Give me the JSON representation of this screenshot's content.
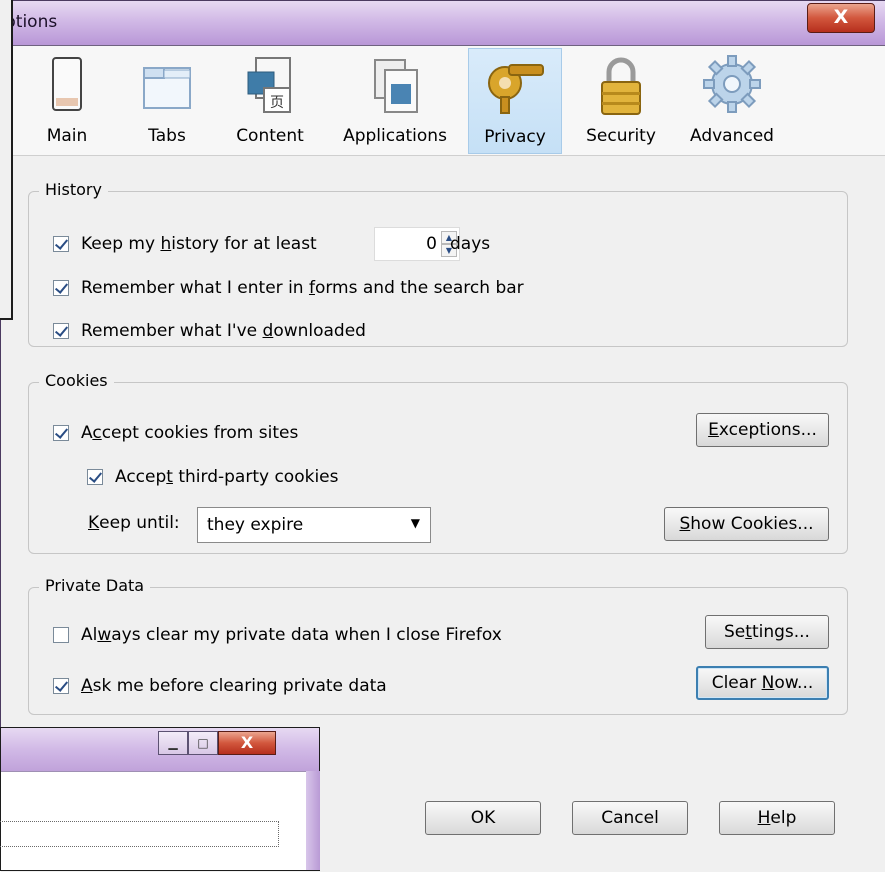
{
  "window": {
    "title": "Options",
    "title_visible": "ptions",
    "close_label": "X"
  },
  "toolbar": {
    "items": [
      {
        "label": "Main",
        "icon": "main-window-icon"
      },
      {
        "label": "Tabs",
        "icon": "tabs-icon"
      },
      {
        "label": "Content",
        "icon": "content-icon"
      },
      {
        "label": "Applications",
        "icon": "applications-icon"
      },
      {
        "label": "Privacy",
        "icon": "privacy-key-icon",
        "selected": true
      },
      {
        "label": "Security",
        "icon": "padlock-icon"
      },
      {
        "label": "Advanced",
        "icon": "gear-icon"
      }
    ]
  },
  "history": {
    "legend": "History",
    "keep_history_pre": "Keep my ",
    "keep_history_u": "h",
    "keep_history_post": "istory for at least",
    "days_value": "0",
    "days_label": "days",
    "forms_pre": "Remember what I enter in ",
    "forms_u": "f",
    "forms_post": "orms and the search bar",
    "downloads_pre": "Remember what I've ",
    "downloads_u": "d",
    "downloads_post": "ownloaded"
  },
  "cookies": {
    "legend": "Cookies",
    "accept_pre": "A",
    "accept_u": "c",
    "accept_post": "cept cookies from sites",
    "third_pre": "Accep",
    "third_u": "t",
    "third_post": " third-party cookies",
    "keep_until_u": "K",
    "keep_until_post": "eep until:",
    "keep_until_value": "they expire",
    "exceptions_u": "E",
    "exceptions_post": "xceptions...",
    "show_u": "S",
    "show_post": "how Cookies..."
  },
  "private_data": {
    "legend": "Private Data",
    "always_pre": "Al",
    "always_u": "w",
    "always_post": "ays clear my private data when I close Firefox",
    "ask_u": "A",
    "ask_post": "sk me before clearing private data",
    "settings_pre": "Se",
    "settings_u": "t",
    "settings_post": "tings...",
    "clear_pre": "Clear ",
    "clear_u": "N",
    "clear_post": "ow..."
  },
  "footer": {
    "ok": "OK",
    "cancel": "Cancel",
    "help_u": "H",
    "help_post": "elp"
  },
  "background_window": {
    "minimize_icon": "minimize-icon",
    "maximize_icon": "maximize-icon",
    "close_label": "X"
  },
  "colors": {
    "aero_title": "#d1b9e6",
    "selected_tab": "#c5e0f6",
    "close_red": "#d2573d",
    "focus_blue": "#3c7fb1"
  }
}
